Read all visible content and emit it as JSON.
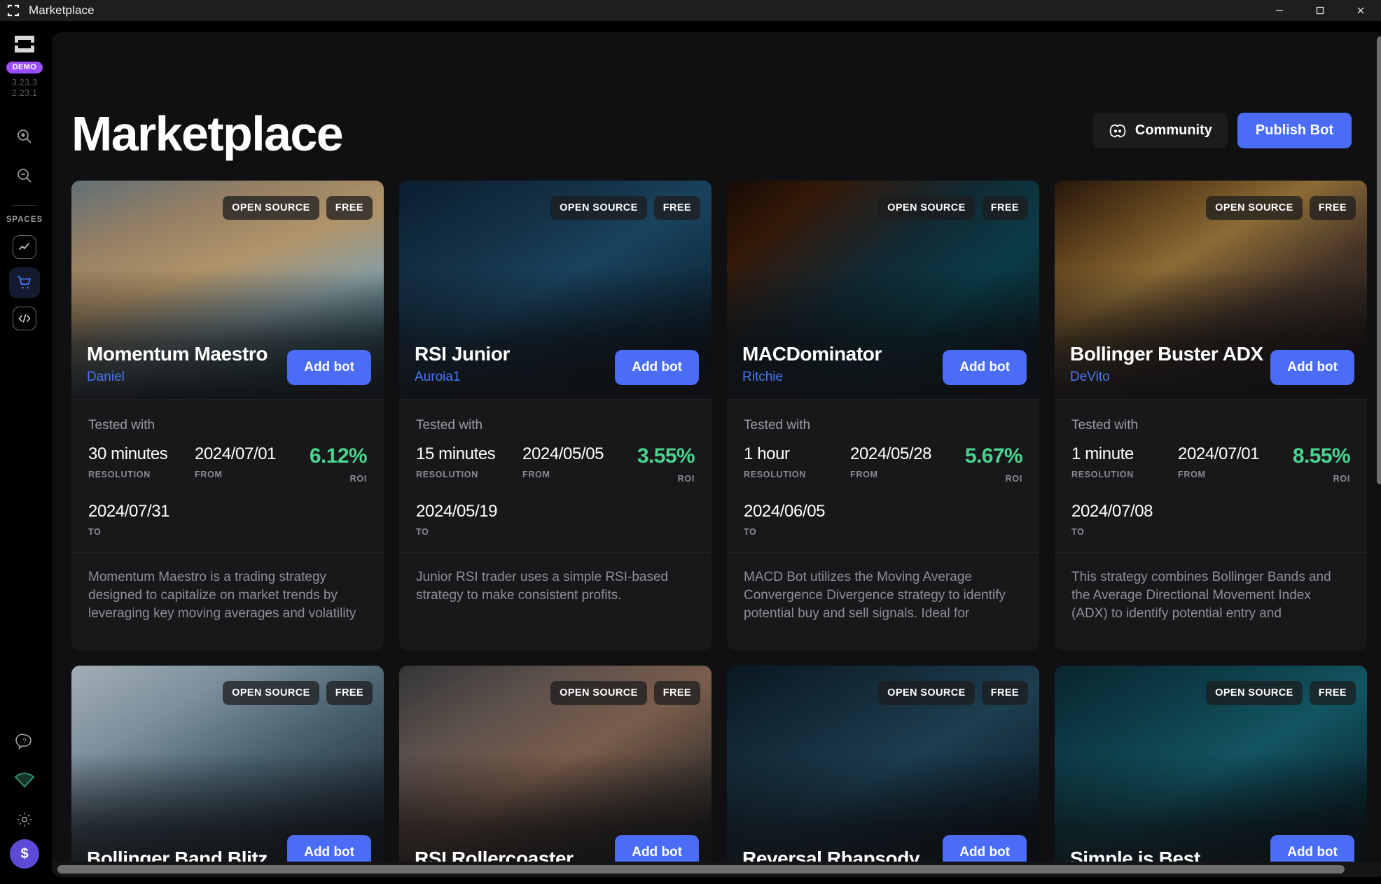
{
  "window": {
    "title": "Marketplace",
    "app_icon": "frame-logo-icon",
    "minimize": "—",
    "maximize": "□",
    "close": "✕"
  },
  "sidebar": {
    "brand_icon": "frame-logo-icon",
    "demo_badge": "DEMO",
    "version_primary": "3.23.3",
    "version_secondary": "2.23.1",
    "zoom_in_icon": "zoom-in-icon",
    "zoom_out_icon": "zoom-out-icon",
    "spaces_label": "SPACES",
    "items": [
      {
        "icon": "chart-line-icon",
        "active": false
      },
      {
        "icon": "shopping-cart-icon",
        "active": true
      },
      {
        "icon": "code-brackets-icon",
        "active": false
      }
    ],
    "bottom_items": [
      {
        "icon": "help-question-icon"
      },
      {
        "icon": "wifi-signal-icon"
      },
      {
        "icon": "gear-settings-icon"
      }
    ],
    "avatar_label": "$",
    "accent_active": "#4a78f7",
    "accent_demo": "#9b4dff",
    "accent_wifi": "#2f9e6b",
    "accent_avatar": "#5b4bd6"
  },
  "header": {
    "title": "Marketplace",
    "community_label": "Community",
    "community_icon": "discord-icon",
    "publish_label": "Publish Bot",
    "publish_color": "#4a6cf7"
  },
  "labels": {
    "tested_with": "Tested with",
    "resolution": "RESOLUTION",
    "from": "FROM",
    "to": "TO",
    "roi": "ROI",
    "add_bot": "Add bot",
    "badge_open_source": "OPEN SOURCE",
    "badge_free": "FREE",
    "roi_color": "#4ad48d"
  },
  "cards": [
    {
      "name": "Momentum Maestro",
      "author": "Daniel",
      "badges": [
        "OPEN SOURCE",
        "FREE"
      ],
      "action": "Add bot",
      "resolution": "30 minutes",
      "from": "2024/07/01",
      "to": "2024/07/31",
      "roi": "6.12%",
      "description": "Momentum Maestro is a trading strategy designed to capitalize on market trends by leveraging key moving averages and volatility",
      "hero": "woman-laptop-beach"
    },
    {
      "name": "RSI Junior",
      "author": "Auroia1",
      "badges": [
        "OPEN SOURCE",
        "FREE"
      ],
      "action": "Add bot",
      "resolution": "15 minutes",
      "from": "2024/05/05",
      "to": "2024/05/19",
      "roi": "3.55%",
      "description": "Junior RSI trader uses a simple RSI-based strategy to make consistent profits.",
      "hero": "trader-office-monitors"
    },
    {
      "name": "MACDominator",
      "author": "Ritchie",
      "badges": [
        "OPEN SOURCE",
        "FREE"
      ],
      "action": "Add bot",
      "resolution": "1 hour",
      "from": "2024/05/28",
      "to": "2024/06/05",
      "roi": "5.67%",
      "description": "MACD Bot utilizes the Moving Average Convergence Divergence strategy to identify potential buy and sell signals. Ideal for",
      "hero": "candlestick-data-grid"
    },
    {
      "name": "Bollinger Buster ADX",
      "author": "DeVito",
      "badges": [
        "OPEN SOURCE",
        "FREE"
      ],
      "action": "Add bot",
      "resolution": "1 minute",
      "from": "2024/07/01",
      "to": "2024/07/08",
      "roi": "8.55%",
      "description": "This strategy combines Bollinger Bands and the Average Directional Movement Index (ADX) to identify potential entry and",
      "hero": "woman-vr-headset"
    }
  ],
  "cards_row2": [
    {
      "name": "Bollinger Band Blitz",
      "badges": [
        "OPEN SOURCE",
        "FREE"
      ],
      "action": "Add bot",
      "hero": "analyst-bollinger-screens"
    },
    {
      "name": "RSI Rollercoaster",
      "badges": [
        "OPEN SOURCE",
        "FREE"
      ],
      "action": "Add bot",
      "hero": "rollercoaster-track"
    },
    {
      "name": "Reversal Rhapsody",
      "badges": [
        "OPEN SOURCE",
        "FREE"
      ],
      "action": "Add bot",
      "hero": "traders-city-night"
    },
    {
      "name": "Simple is Best",
      "badges": [
        "OPEN SOURCE",
        "FREE"
      ],
      "action": "Add bot",
      "hero": "teal-dashboard-charts"
    }
  ]
}
